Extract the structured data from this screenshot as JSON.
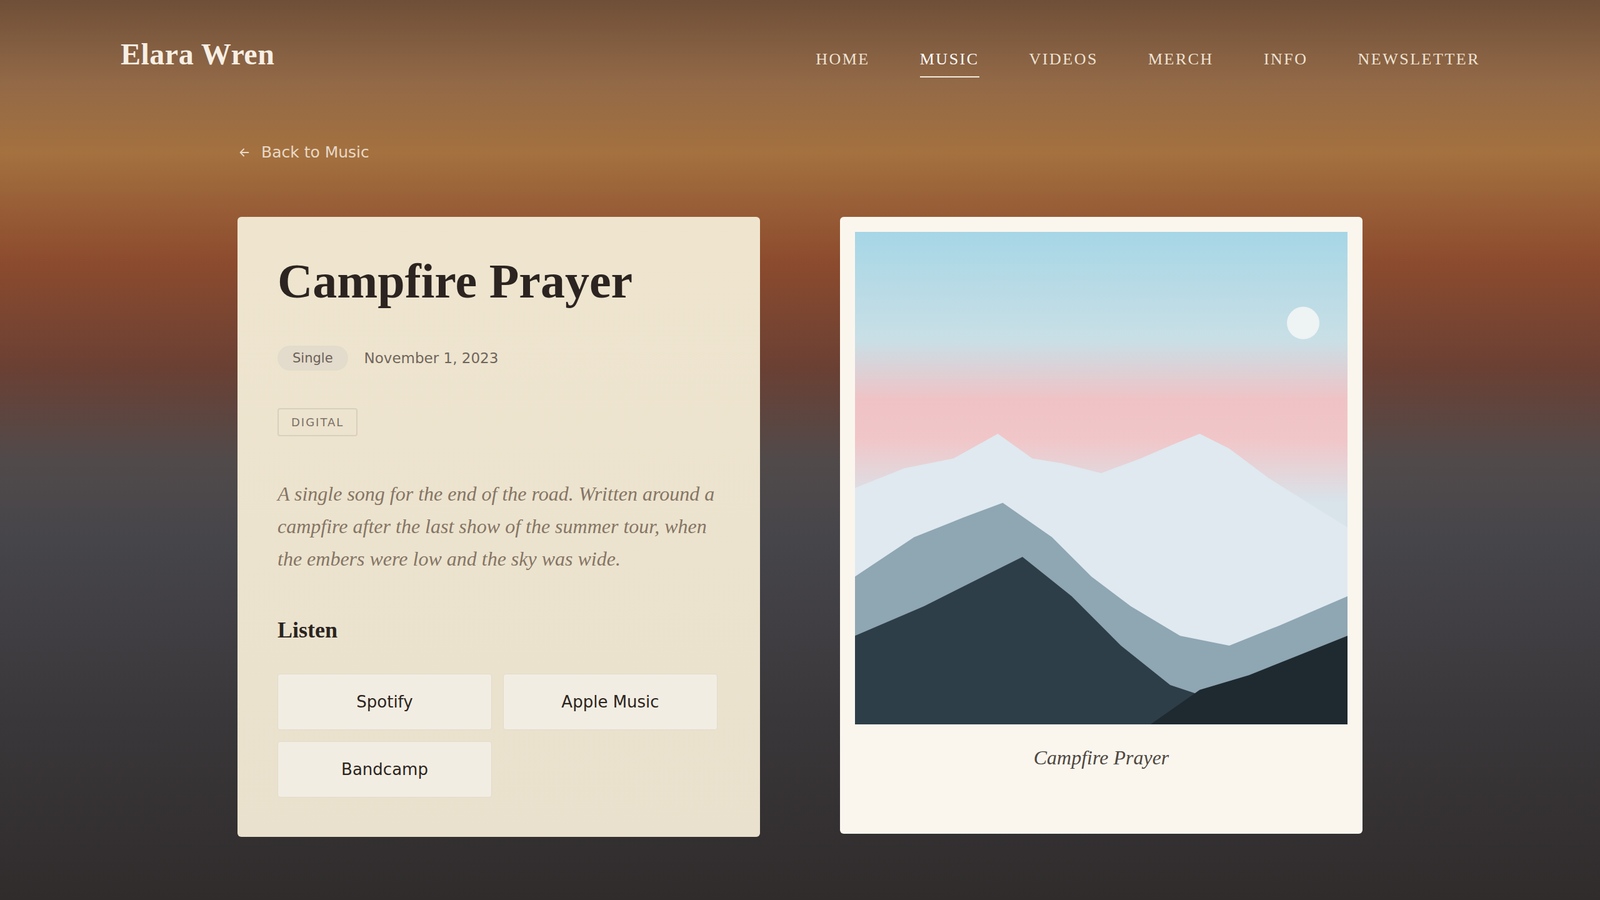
{
  "header": {
    "logo": "Elara Wren"
  },
  "nav": [
    {
      "label": "HOME",
      "selected": false
    },
    {
      "label": "MUSIC",
      "selected": true
    },
    {
      "label": "VIDEOS",
      "selected": false
    },
    {
      "label": "MERCH",
      "selected": false
    },
    {
      "label": "INFO",
      "selected": false
    },
    {
      "label": "NEWSLETTER",
      "selected": false
    }
  ],
  "back_link": {
    "label": "Back to Music"
  },
  "release": {
    "title": "Campfire Prayer",
    "type": "Single",
    "date": "November 1, 2023",
    "formats": [
      "DIGITAL"
    ],
    "description": "A single song for the end of the road. Written around a campfire after the last show of the summer tour, when the embers were low and the sky was wide.",
    "listen_heading": "Listen",
    "links": [
      "Spotify",
      "Apple Music",
      "Bandcamp"
    ]
  },
  "cover": {
    "caption": "Campfire Prayer"
  }
}
